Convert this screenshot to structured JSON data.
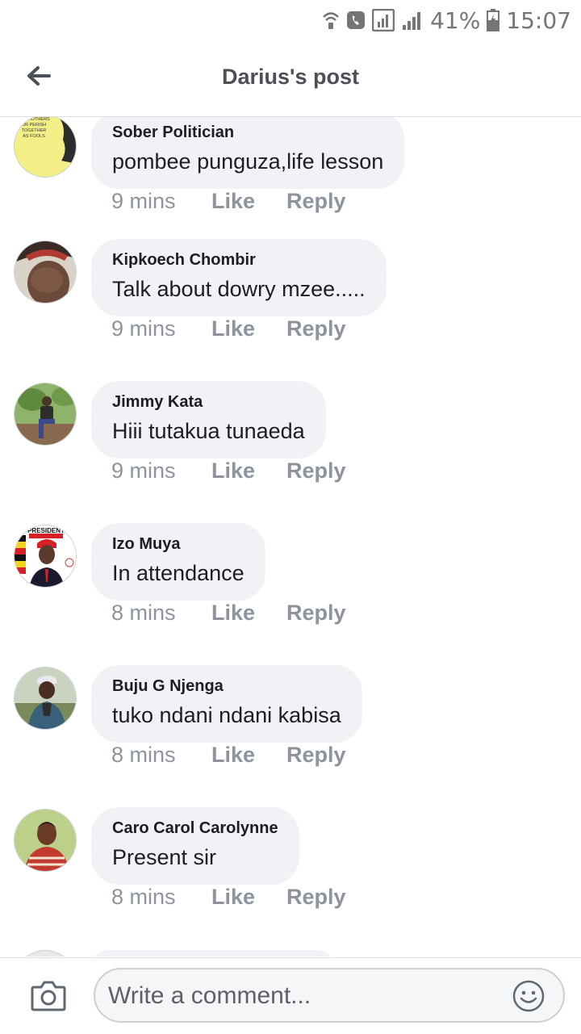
{
  "status_bar": {
    "battery": "41%",
    "time": "15:07"
  },
  "header": {
    "title": "Darius's post"
  },
  "comments": [
    {
      "name": "Sober Politician",
      "text": "pombee punguza,life lesson",
      "time": "9 mins",
      "like": "Like",
      "reply": "Reply",
      "avatar_text": "AS BROTHERS OR PERISH TOGETHER AS FOOLS"
    },
    {
      "name": "Kipkoech Chombir",
      "text": "Talk about dowry mzee.....",
      "time": "9 mins",
      "like": "Like",
      "reply": "Reply"
    },
    {
      "name": "Jimmy Kata",
      "text": "Hiii tutakua tunaeda",
      "time": "9 mins",
      "like": "Like",
      "reply": "Reply"
    },
    {
      "name": "Izo Muya",
      "text": "In attendance",
      "time": "8 mins",
      "like": "Like",
      "reply": "Reply",
      "avatar_text": "PRESIDENT"
    },
    {
      "name": "Buju G Njenga",
      "text": "tuko ndani ndani kabisa",
      "time": "8 mins",
      "like": "Like",
      "reply": "Reply"
    },
    {
      "name": "Caro Carol Carolynne",
      "text": "Present sir",
      "time": "8 mins",
      "like": "Like",
      "reply": "Reply"
    }
  ],
  "composer": {
    "placeholder": "Write a comment..."
  },
  "icons": {
    "back": "back-arrow-icon",
    "camera": "camera-icon",
    "emoji": "emoji-icon"
  },
  "colors": {
    "bubble": "#f0f2f5",
    "meta_text": "#8d949e",
    "title_text": "#4b4f56"
  }
}
